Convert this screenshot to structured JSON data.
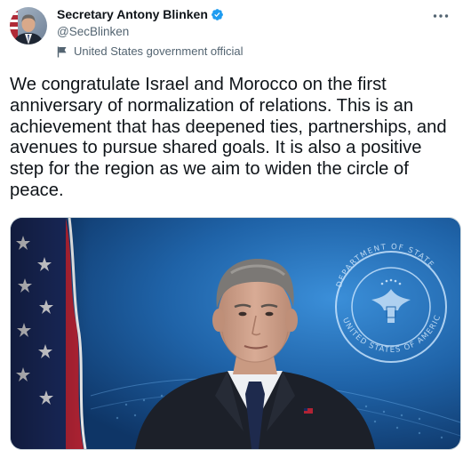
{
  "tweet": {
    "author": {
      "display_name": "Secretary Antony Blinken",
      "handle": "@SecBlinken",
      "verified": true,
      "label": "United States government official"
    },
    "text": "We congratulate Israel and Morocco on the first anniversary of normalization of relations. This is an achievement that has deepened ties, partnerships, and avenues to pursue shared goals. It is also a positive step for the region as we aim to widen the circle of peace.",
    "more_icon": "ellipsis-icon",
    "media": {
      "seal_text_top": "DEPARTMENT OF STATE",
      "seal_text_bottom": "UNITED STATES OF AMERICA"
    }
  },
  "colors": {
    "text_primary": "#0f1419",
    "text_secondary": "#536471",
    "verified_blue": "#1d9bf0",
    "media_blue": "#1b5fa3"
  }
}
